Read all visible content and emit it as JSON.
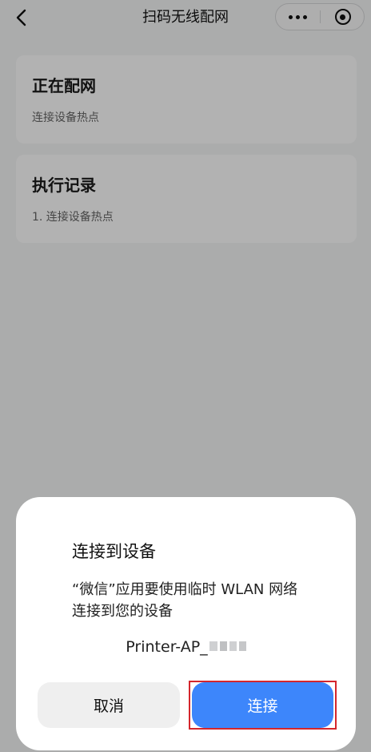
{
  "navbar": {
    "title": "扫码无线配网",
    "back_icon": "chevron-left-icon",
    "more_icon": "more-dots-icon",
    "close_icon": "target-circle-icon"
  },
  "cards": [
    {
      "title": "正在配网",
      "subtitle": "连接设备热点"
    },
    {
      "title": "执行记录",
      "subtitle": "1. 连接设备热点"
    }
  ],
  "dialog": {
    "title": "连接到设备",
    "message": "“微信”应用要使用临时 WLAN 网络连接到您的设备",
    "ssid_prefix": "Printer-AP_",
    "cancel_label": "取消",
    "connect_label": "连接"
  },
  "colors": {
    "primary": "#3d86fb",
    "highlight": "#d4262c",
    "overlay": "rgba(0,0,0,0.30)"
  }
}
